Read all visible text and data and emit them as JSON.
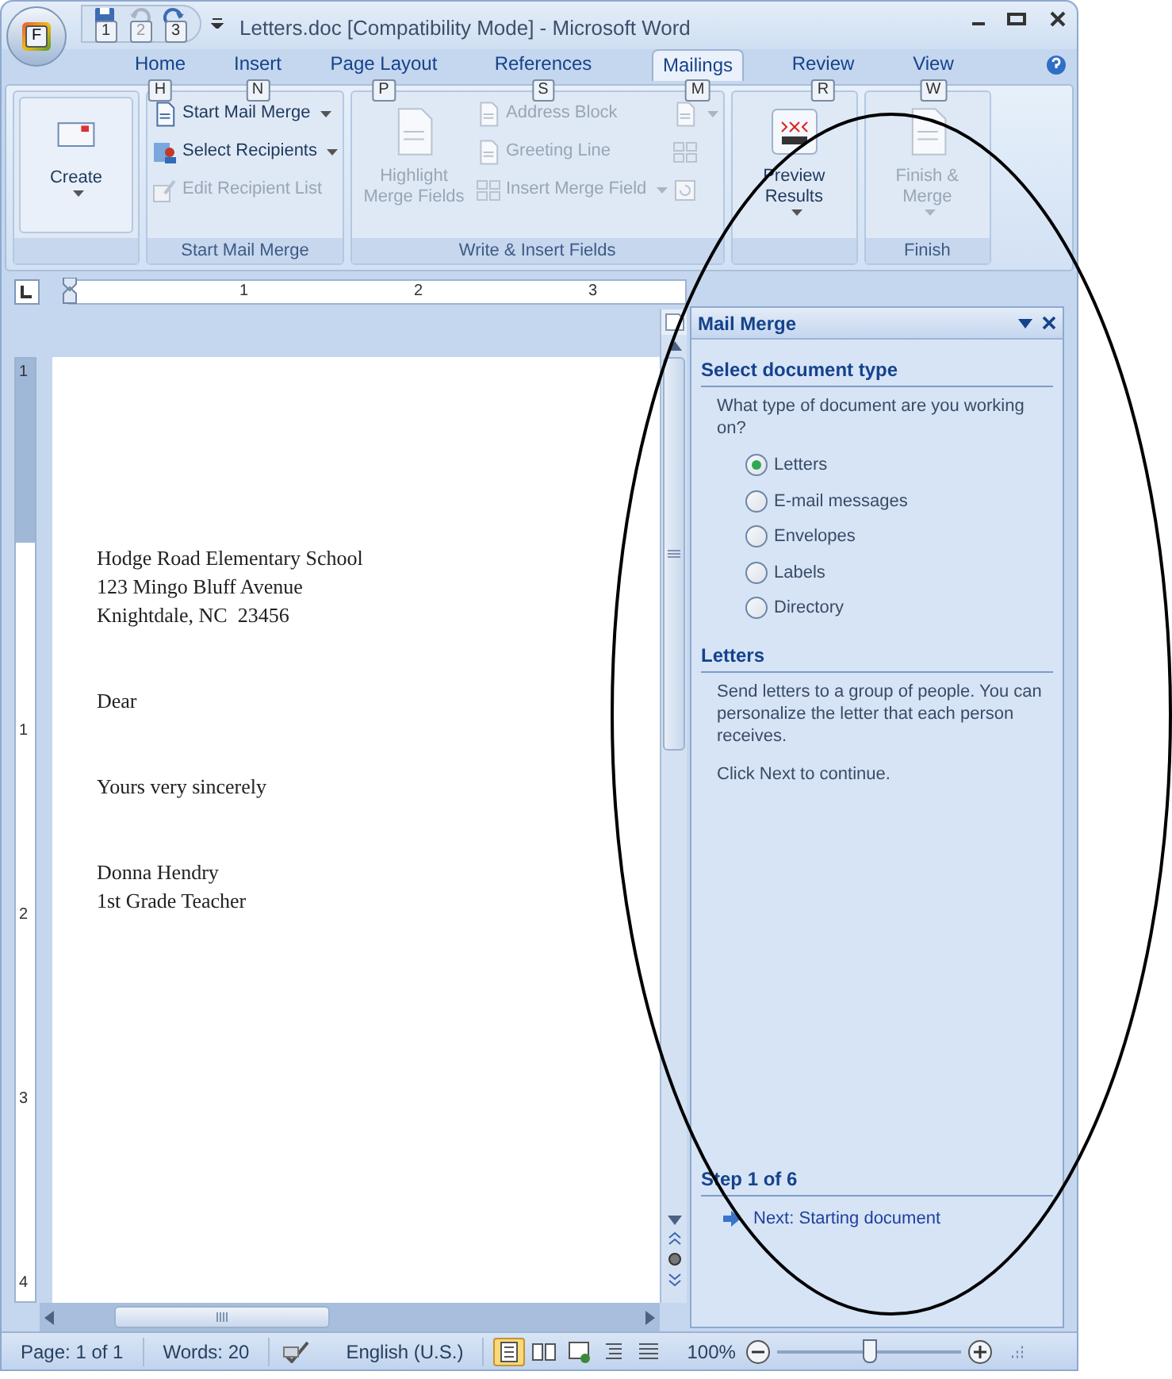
{
  "window": {
    "title": "Letters.doc [Compatibility Mode] - Microsoft Word"
  },
  "office_button": {
    "keytip": "F"
  },
  "quick_access": [
    {
      "kind": "save",
      "keytip": "1",
      "disabled": false
    },
    {
      "kind": "undo",
      "keytip": "2",
      "disabled": true
    },
    {
      "kind": "redo",
      "keytip": "3",
      "disabled": false
    }
  ],
  "tabs": [
    {
      "label": "Home",
      "keytip": "H",
      "selected": false
    },
    {
      "label": "Insert",
      "keytip": "N",
      "selected": false
    },
    {
      "label": "Page Layout",
      "keytip": "P",
      "selected": false
    },
    {
      "label": "References",
      "keytip": "S",
      "selected": false
    },
    {
      "label": "Mailings",
      "keytip": "M",
      "selected": true
    },
    {
      "label": "Review",
      "keytip": "R",
      "selected": false
    },
    {
      "label": "View",
      "keytip": "W",
      "selected": false
    }
  ],
  "ribbon_groups": [
    {
      "items": [
        {
          "kind": "large",
          "label": "Create",
          "dropdown": true,
          "disabled": false
        }
      ]
    },
    {
      "label": "Start Mail Merge",
      "items": [
        {
          "kind": "small",
          "label": "Start Mail Merge",
          "dropdown": true,
          "disabled": false
        },
        {
          "kind": "small",
          "label": "Select Recipients",
          "dropdown": true,
          "disabled": false
        },
        {
          "kind": "small",
          "label": "Edit Recipient List",
          "dropdown": false,
          "disabled": true
        }
      ]
    },
    {
      "label": "Write & Insert Fields",
      "items": [
        {
          "kind": "large",
          "label": "Highlight Merge Fields",
          "dropdown": false,
          "disabled": true
        },
        {
          "kind": "small",
          "label": "Address Block",
          "dropdown": false,
          "disabled": true
        },
        {
          "kind": "small",
          "label": "Greeting Line",
          "dropdown": false,
          "disabled": true
        },
        {
          "kind": "small",
          "label": "Insert Merge Field",
          "dropdown": true,
          "disabled": true
        },
        {
          "kind": "icon",
          "dropdown": true,
          "disabled": true
        },
        {
          "kind": "icon",
          "dropdown": false,
          "disabled": true
        },
        {
          "kind": "icon",
          "dropdown": false,
          "disabled": true
        }
      ]
    },
    {
      "items": [
        {
          "kind": "large",
          "label": "Preview Results",
          "dropdown": true,
          "disabled": false
        }
      ]
    },
    {
      "label": "Finish",
      "items": [
        {
          "kind": "large",
          "label": "Finish & Merge",
          "dropdown": true,
          "disabled": true
        }
      ]
    }
  ],
  "ruler": {
    "labels": [
      "1",
      "2",
      "3"
    ]
  },
  "vertical_ruler": {
    "labels": [
      "1",
      "1",
      "2",
      "3",
      "4"
    ]
  },
  "document": {
    "paragraphs": [
      {
        "lines": [
          "Hodge Road Elementary School",
          "123 Mingo Bluff Avenue",
          "Knightdale, NC  23456"
        ]
      },
      {
        "lines": [
          "Dear"
        ]
      },
      {
        "lines": [
          "Yours very sincerely"
        ]
      },
      {
        "lines": [
          "Donna Hendry",
          "1st Grade Teacher"
        ]
      }
    ]
  },
  "task_pane": {
    "title": "Mail Merge",
    "sections": [
      {
        "heading": "Select document type",
        "texts": [
          "What type of document are you working on?"
        ],
        "options": [
          {
            "label": "Letters",
            "selected": true
          },
          {
            "label": "E-mail messages",
            "selected": false
          },
          {
            "label": "Envelopes",
            "selected": false
          },
          {
            "label": "Labels",
            "selected": false
          },
          {
            "label": "Directory",
            "selected": false
          }
        ]
      },
      {
        "heading": "Letters",
        "texts": [
          "Send letters to a group of people. You can personalize the letter that each person receives.",
          "Click Next to continue."
        ]
      }
    ],
    "step": "Step 1 of 6",
    "next_link": "Next: Starting document"
  },
  "status_bar": {
    "page": "Page: 1 of 1",
    "words": "Words: 20",
    "language": "English (U.S.)",
    "views": [
      {
        "kind": "print",
        "selected": true
      },
      {
        "kind": "reading",
        "selected": false
      },
      {
        "kind": "web",
        "selected": false
      },
      {
        "kind": "outline",
        "selected": false
      },
      {
        "kind": "draft",
        "selected": false
      }
    ],
    "zoom": "100%",
    "zoom_slider": {
      "level": 0.5
    }
  }
}
